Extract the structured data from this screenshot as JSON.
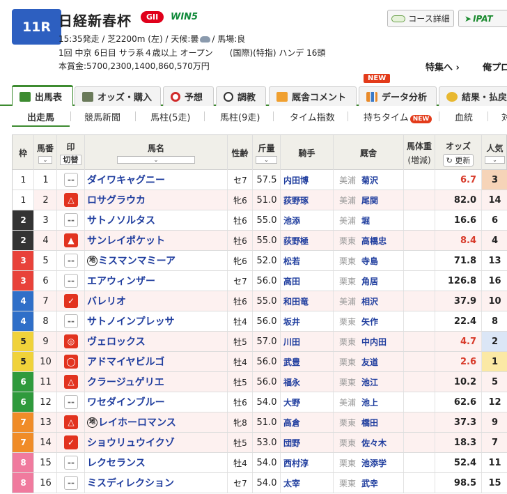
{
  "race": {
    "number": "11R",
    "name": "日経新春杯",
    "grade": "GII",
    "win5": "WIN5",
    "line1_pre": "15:35発走 / 芝2200m (左) / 天候:曇",
    "line1_post": "/ 馬場:良",
    "line2": "1回 中京 6日目 サラ系４歳以上 オープン　　(国際)(特指) ハンデ 16頭",
    "line3": "本賞金:5700,2300,1400,860,570万円"
  },
  "header_links": {
    "course": "コース詳細",
    "ipat": "IPAT",
    "tokushu": "特集へ ›",
    "ore": "俺プロ"
  },
  "tabs": [
    {
      "label": "出馬表",
      "icon": "table-icon"
    },
    {
      "label": "オッズ・購入",
      "icon": "odds-icon"
    },
    {
      "label": "予想",
      "icon": "target-icon"
    },
    {
      "label": "調教",
      "icon": "stopwatch-icon"
    },
    {
      "label": "厩舎コメント",
      "icon": "stable-icon"
    },
    {
      "label": "データ分析",
      "icon": "chart-icon"
    },
    {
      "label": "結果・払戻",
      "icon": "coins-icon"
    }
  ],
  "new_badge": "NEW",
  "subtabs": [
    "出走馬",
    "競馬新聞",
    "馬柱(5走)",
    "馬柱(9走)",
    "タイム指数",
    "持ちタイム",
    "血統",
    "対"
  ],
  "subtab_new": "NEW",
  "headers": {
    "waku": "枠",
    "umaban": "馬番",
    "mark": "印",
    "mark_toggle": "切替",
    "horse": "馬名",
    "sex_age": "性齢",
    "weight": "斤量",
    "jockey": "騎手",
    "trainer": "厩舎",
    "body_weight": "馬体重",
    "body_weight_sub": "(増減)",
    "odds": "オッズ",
    "odds_refresh": "更新",
    "popularity": "人気"
  },
  "waku_colors": {
    "1": "#ffffff",
    "2": "#333333",
    "3": "#e8423a",
    "4": "#2f6fc8",
    "5": "#f0d23a",
    "6": "#2f9a3c",
    "7": "#f08c28",
    "8": "#f07a9e"
  },
  "rows": [
    {
      "waku": "1",
      "num": "1",
      "mark": "--",
      "chi": "",
      "horse": "ダイワキャグニー",
      "sex": "セ7",
      "weight": "57.5",
      "jockey": "内田博",
      "region": "美浦",
      "trainer": "菊沢",
      "odds": "6.7",
      "pop": "3",
      "hl": false
    },
    {
      "waku": "1",
      "num": "2",
      "mark": "△",
      "chi": "",
      "horse": "ロサグラウカ",
      "sex": "牝6",
      "weight": "51.0",
      "jockey": "荻野琢",
      "region": "美浦",
      "trainer": "尾関",
      "odds": "82.0",
      "pop": "14",
      "hl": true
    },
    {
      "waku": "2",
      "num": "3",
      "mark": "--",
      "chi": "",
      "horse": "サトノソルタス",
      "sex": "牡6",
      "weight": "55.0",
      "jockey": "池添",
      "region": "美浦",
      "trainer": "堀",
      "odds": "16.6",
      "pop": "6",
      "hl": false
    },
    {
      "waku": "2",
      "num": "4",
      "mark": "▲",
      "chi": "",
      "horse": "サンレイポケット",
      "sex": "牡6",
      "weight": "55.0",
      "jockey": "荻野極",
      "region": "栗東",
      "trainer": "高橋忠",
      "odds": "8.4",
      "pop": "4",
      "hl": true
    },
    {
      "waku": "3",
      "num": "5",
      "mark": "--",
      "chi": "地",
      "horse": "ミスマンマミーア",
      "sex": "牝6",
      "weight": "52.0",
      "jockey": "松若",
      "region": "栗東",
      "trainer": "寺島",
      "odds": "71.8",
      "pop": "13",
      "hl": false
    },
    {
      "waku": "3",
      "num": "6",
      "mark": "--",
      "chi": "",
      "horse": "エアウィンザー",
      "sex": "セ7",
      "weight": "56.0",
      "jockey": "高田",
      "region": "栗東",
      "trainer": "角居",
      "odds": "126.8",
      "pop": "16",
      "hl": false
    },
    {
      "waku": "4",
      "num": "7",
      "mark": "✓",
      "chi": "",
      "horse": "バレリオ",
      "sex": "牡6",
      "weight": "55.0",
      "jockey": "和田竜",
      "region": "美浦",
      "trainer": "相沢",
      "odds": "37.9",
      "pop": "10",
      "hl": true
    },
    {
      "waku": "4",
      "num": "8",
      "mark": "--",
      "chi": "",
      "horse": "サトノインプレッサ",
      "sex": "牡4",
      "weight": "56.0",
      "jockey": "坂井",
      "region": "栗東",
      "trainer": "矢作",
      "odds": "22.4",
      "pop": "8",
      "hl": false
    },
    {
      "waku": "5",
      "num": "9",
      "mark": "◎",
      "chi": "",
      "horse": "ヴェロックス",
      "sex": "牡5",
      "weight": "57.0",
      "jockey": "川田",
      "region": "栗東",
      "trainer": "中内田",
      "odds": "4.7",
      "pop": "2",
      "hl": true
    },
    {
      "waku": "5",
      "num": "10",
      "mark": "◯",
      "chi": "",
      "horse": "アドマイヤビルゴ",
      "sex": "牡4",
      "weight": "56.0",
      "jockey": "武豊",
      "region": "栗東",
      "trainer": "友道",
      "odds": "2.6",
      "pop": "1",
      "hl": true
    },
    {
      "waku": "6",
      "num": "11",
      "mark": "△",
      "chi": "",
      "horse": "クラージュゲリエ",
      "sex": "牡5",
      "weight": "56.0",
      "jockey": "福永",
      "region": "栗東",
      "trainer": "池江",
      "odds": "10.2",
      "pop": "5",
      "hl": true
    },
    {
      "waku": "6",
      "num": "12",
      "mark": "--",
      "chi": "",
      "horse": "ワセダインブルー",
      "sex": "牡6",
      "weight": "54.0",
      "jockey": "大野",
      "region": "美浦",
      "trainer": "池上",
      "odds": "62.6",
      "pop": "12",
      "hl": false
    },
    {
      "waku": "7",
      "num": "13",
      "mark": "△",
      "chi": "地",
      "horse": "レイホーロマンス",
      "sex": "牝8",
      "weight": "51.0",
      "jockey": "高倉",
      "region": "栗東",
      "trainer": "橋田",
      "odds": "37.3",
      "pop": "9",
      "hl": true
    },
    {
      "waku": "7",
      "num": "14",
      "mark": "✓",
      "chi": "",
      "horse": "ショウリュウイクゾ",
      "sex": "牡5",
      "weight": "53.0",
      "jockey": "団野",
      "region": "栗東",
      "trainer": "佐々木",
      "odds": "18.3",
      "pop": "7",
      "hl": true
    },
    {
      "waku": "8",
      "num": "15",
      "mark": "--",
      "chi": "",
      "horse": "レクセランス",
      "sex": "牡4",
      "weight": "54.0",
      "jockey": "西村淳",
      "region": "栗東",
      "trainer": "池添学",
      "odds": "52.4",
      "pop": "11",
      "hl": false
    },
    {
      "waku": "8",
      "num": "16",
      "mark": "--",
      "chi": "",
      "horse": "ミスディレクション",
      "sex": "セ7",
      "weight": "54.0",
      "jockey": "太宰",
      "region": "栗東",
      "trainer": "武幸",
      "odds": "98.5",
      "pop": "15",
      "hl": false
    }
  ]
}
